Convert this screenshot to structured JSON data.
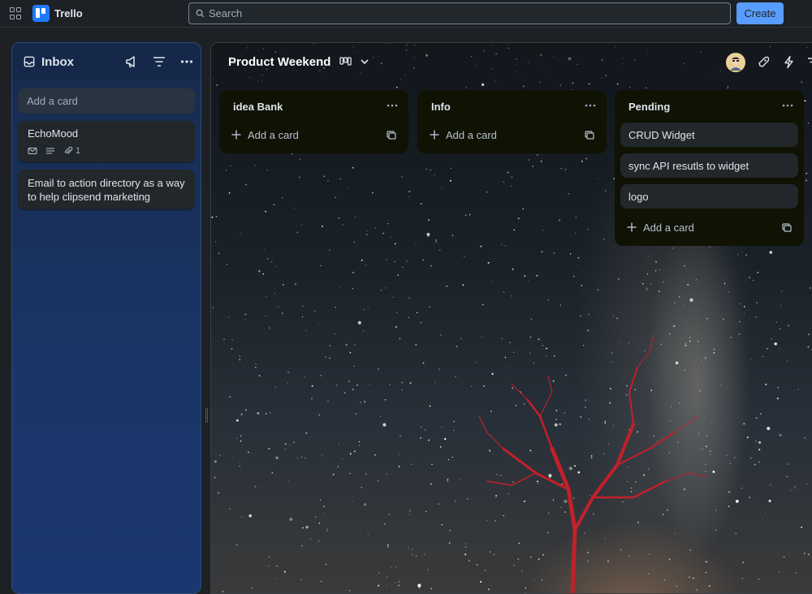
{
  "topbar": {
    "app_name": "Trello",
    "search_placeholder": "Search",
    "create_label": "Create",
    "brand_color": "#1d7afc"
  },
  "inbox": {
    "title": "Inbox",
    "add_card_placeholder": "Add a card",
    "cards": [
      {
        "title": "EchoMood",
        "attachments": "1"
      },
      {
        "title": "Email to action directory as a way to help clipsend marketing"
      }
    ]
  },
  "board": {
    "title": "Product Weekend",
    "lists": [
      {
        "title": "idea Bank",
        "cards": [],
        "add_label": "Add a card"
      },
      {
        "title": "Info",
        "cards": [],
        "add_label": "Add a card"
      },
      {
        "title": "Pending",
        "cards": [
          "CRUD Widget",
          "sync API resutls to widget",
          "logo"
        ],
        "add_label": "Add a card"
      }
    ]
  },
  "icons": [
    "grid-icon",
    "search-icon",
    "inbox-icon",
    "megaphone-icon",
    "filter-icon",
    "more-icon",
    "board-view-icon",
    "chevron-down-icon",
    "rocket-icon",
    "lightning-icon",
    "plus-icon",
    "template-icon",
    "mail-icon",
    "description-icon",
    "paperclip-icon"
  ]
}
